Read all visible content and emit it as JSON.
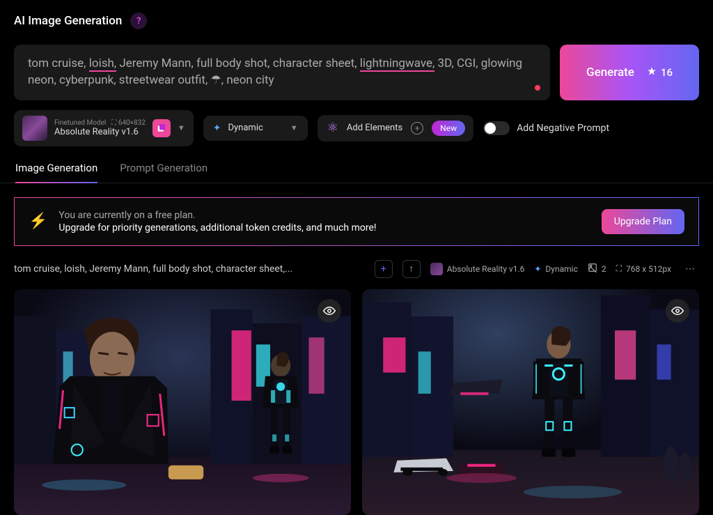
{
  "header": {
    "title": "AI Image Generation",
    "help_icon": "?"
  },
  "prompt": {
    "text_parts": [
      "tom cruise, ",
      "loish,",
      " Jeremy Mann, full body shot, character sheet, ",
      "lightningwave,",
      " 3D, CGI, glowing neon, cyberpunk, streetwear outfit, ☂, neon city"
    ]
  },
  "generate": {
    "label": "Generate",
    "tokens": "16"
  },
  "model": {
    "label": "Finetuned Model",
    "name": "Absolute Reality v1.6",
    "dimensions": "640×832"
  },
  "style_select": {
    "value": "Dynamic"
  },
  "add_elements": {
    "label": "Add Elements",
    "badge": "New"
  },
  "negative": {
    "label": "Add Negative Prompt"
  },
  "tabs": {
    "image": "Image Generation",
    "prompt": "Prompt Generation"
  },
  "banner": {
    "line1": "You are currently on a free plan.",
    "line2": "Upgrade for priority generations, additional token credits, and much more!",
    "button": "Upgrade Plan"
  },
  "result": {
    "prompt": "tom cruise, loish, Jeremy Mann, full body shot, character sheet,...",
    "model": "Absolute Reality v1.6",
    "style": "Dynamic",
    "count": "2",
    "resolution": "768 x 512px"
  }
}
